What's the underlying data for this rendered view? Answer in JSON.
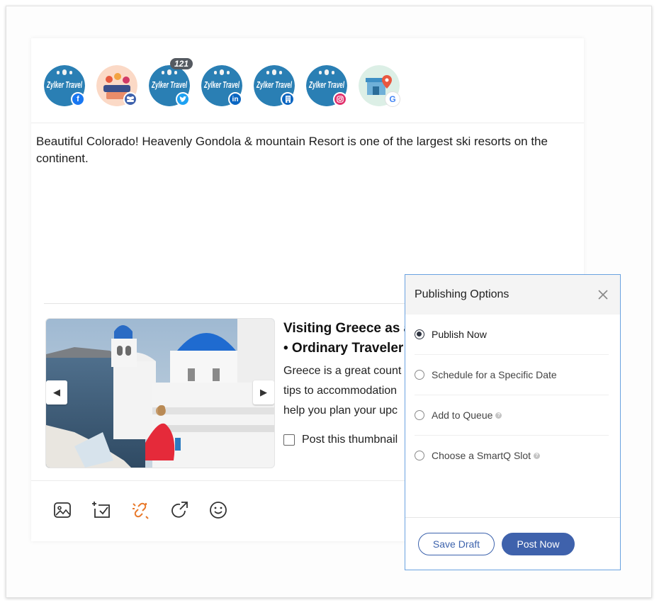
{
  "profiles": [
    {
      "name": "Zylker Travel",
      "network": "facebook-icon",
      "badge_color": "#1877f2",
      "badge_text": "f",
      "count": ""
    },
    {
      "name": "",
      "network": "group-icon",
      "badge_color": "#3f62ac",
      "badge_text": "",
      "count": ""
    },
    {
      "name": "Zylker Travel",
      "network": "twitter-icon",
      "badge_color": "#1da1f2",
      "badge_text": "",
      "count": "121"
    },
    {
      "name": "Zylker Travel",
      "network": "linkedin-icon",
      "badge_color": "#0a66c2",
      "badge_text": "in",
      "count": ""
    },
    {
      "name": "Zylker Travel",
      "network": "linkedin-page-icon",
      "badge_color": "#0a66c2",
      "badge_text": "",
      "count": ""
    },
    {
      "name": "Zylker Travel",
      "network": "instagram-icon",
      "badge_color": "#e1306c",
      "badge_text": "",
      "count": ""
    },
    {
      "name": "",
      "network": "google-business-icon",
      "badge_color": "#ffffff",
      "badge_text": "G",
      "count": ""
    }
  ],
  "post": {
    "text": "Beautiful Colorado! Heavenly Gondola & mountain Resort is one of the largest ski resorts on the continent."
  },
  "link_preview": {
    "title_line1": "Visiting Greece as a",
    "title_line2": "• Ordinary Traveler",
    "desc_line1": "Greece is a great count",
    "desc_line2": "tips to accommodation",
    "desc_line3": "help you plan your upc",
    "thumbnail_label": "Post this thumbnail"
  },
  "panel": {
    "title": "Publishing Options",
    "options": [
      {
        "label": "Publish Now",
        "selected": true,
        "help": false
      },
      {
        "label": "Schedule for a Specific Date",
        "selected": false,
        "help": false
      },
      {
        "label": "Add to Queue",
        "selected": false,
        "help": true
      },
      {
        "label": "Choose a SmartQ Slot",
        "selected": false,
        "help": true
      }
    ],
    "save_draft": "Save Draft",
    "post_now": "Post Now"
  },
  "colors": {
    "accent": "#3f62ac",
    "panel_border": "#6aa2e0",
    "link_icon": "#e8792b"
  }
}
